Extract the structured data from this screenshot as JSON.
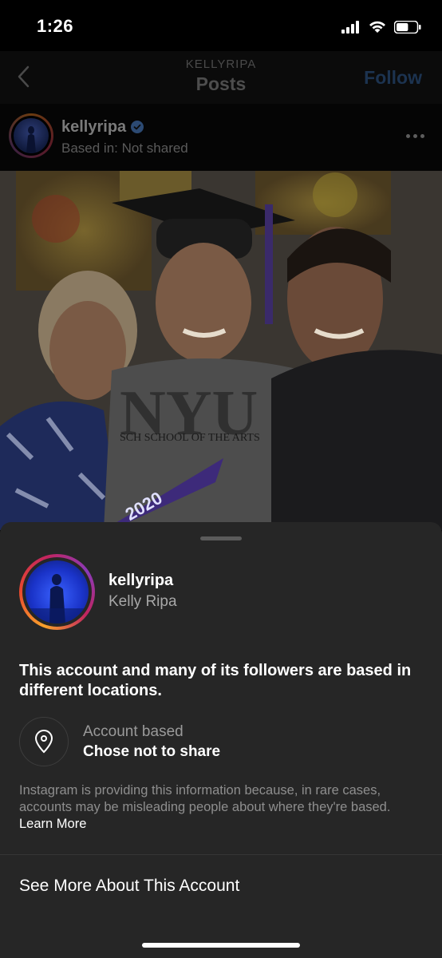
{
  "status_bar": {
    "time": "1:26",
    "battery_level": 0.6
  },
  "header": {
    "subtitle": "KELLYRIPA",
    "title": "Posts",
    "follow_label": "Follow"
  },
  "post_author": {
    "username": "kellyripa",
    "location": "Based in: Not shared"
  },
  "post_photo": {
    "shirt_text_top": "SCH SCHOOL OF THE ARTS",
    "shirt_text_big": "NYU",
    "pennant_text": "2020"
  },
  "sheet": {
    "username": "kellyripa",
    "full_name": "Kelly Ripa",
    "headline": "This account and many of its followers are based in different locations.",
    "account_based_label": "Account based",
    "account_based_value": "Chose not to share",
    "info_text": "Instagram is providing this information because, in rare cases, accounts may be misleading people about where they're based.",
    "learn_more_label": "Learn More",
    "see_more_label": "See More About This Account"
  },
  "colors": {
    "verified": "#3897f0",
    "follow_dimmed": "#1c3350",
    "sheet_bg": "#262626"
  }
}
